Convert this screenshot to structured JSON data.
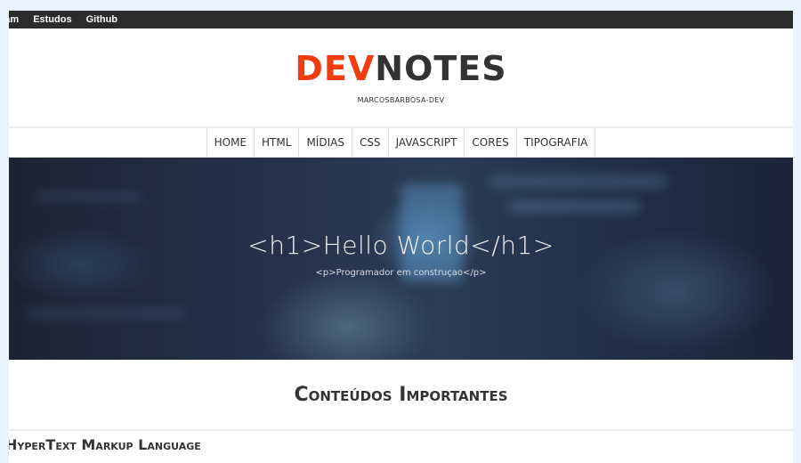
{
  "topbar": {
    "links": [
      "ram",
      "Estudos",
      "Github"
    ]
  },
  "header": {
    "logo_dev": "DEV",
    "logo_notes": "NOTES",
    "subtitle": "MARCOSBARBOSA-DEV"
  },
  "nav": {
    "items": [
      "HOME",
      "HTML",
      "MÍDIAS",
      "CSS",
      "JAVASCRIPT",
      "CORES",
      "TIPOGRAFIA"
    ]
  },
  "hero": {
    "title": "<h1>Hello World</h1>",
    "subtitle": "<p>Programador em construçao</p>"
  },
  "content": {
    "section_title": "Conteúdos Importantes",
    "first_subsection": "HyperText Markup Language"
  },
  "colors": {
    "accent": "#f13c0f",
    "topbar": "#2b2b2b",
    "text": "#333333",
    "page_bg": "#eaf3fd"
  }
}
